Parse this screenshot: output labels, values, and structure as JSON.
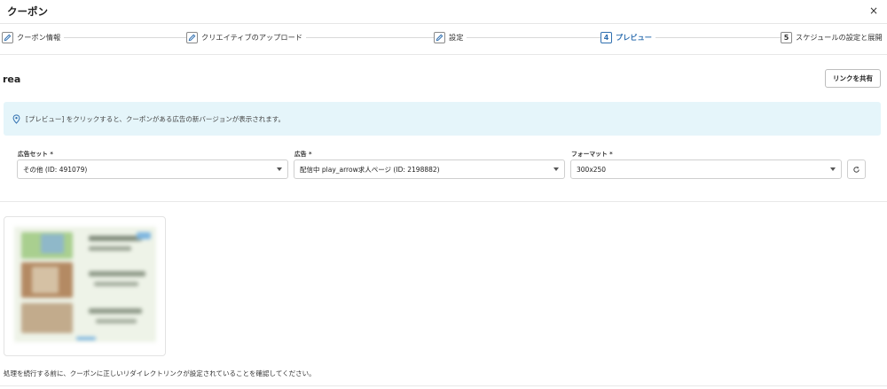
{
  "header": {
    "title": "クーポン",
    "close_label": "×"
  },
  "steps": [
    {
      "number": "",
      "label": "クーポン情報",
      "icon": "pencil-icon",
      "active": false
    },
    {
      "number": "",
      "label": "クリエイティブのアップロード",
      "icon": "pencil-icon",
      "active": false
    },
    {
      "number": "",
      "label": "設定",
      "icon": "pencil-icon",
      "active": false
    },
    {
      "number": "4",
      "label": "プレビュー",
      "icon": "",
      "active": true
    },
    {
      "number": "5",
      "label": "スケジュールの設定と展開",
      "icon": "",
      "active": false
    }
  ],
  "page": {
    "name": "rea",
    "share_label": "リンクを共有"
  },
  "info": {
    "icon": "location-pin-icon",
    "text": "[プレビュー] をクリックすると、クーポンがある広告の新バージョンが表示されます。"
  },
  "fields": {
    "adset": {
      "label": "広告セット *",
      "value": "その他 (ID: 491079)"
    },
    "ad": {
      "label": "広告 *",
      "value": "配信中 play_arrow求人ページ (ID: 2198882)"
    },
    "format": {
      "label": "フォーマット *",
      "value": "300x250"
    }
  },
  "refresh_icon": "refresh-icon",
  "footer": {
    "note": "処理を続行する前に、クーポンに正しいリダイレクトリンクが設定されていることを確認してください。"
  },
  "colors": {
    "accent": "#2f6fb0",
    "info_bg": "#e5f5fa"
  }
}
